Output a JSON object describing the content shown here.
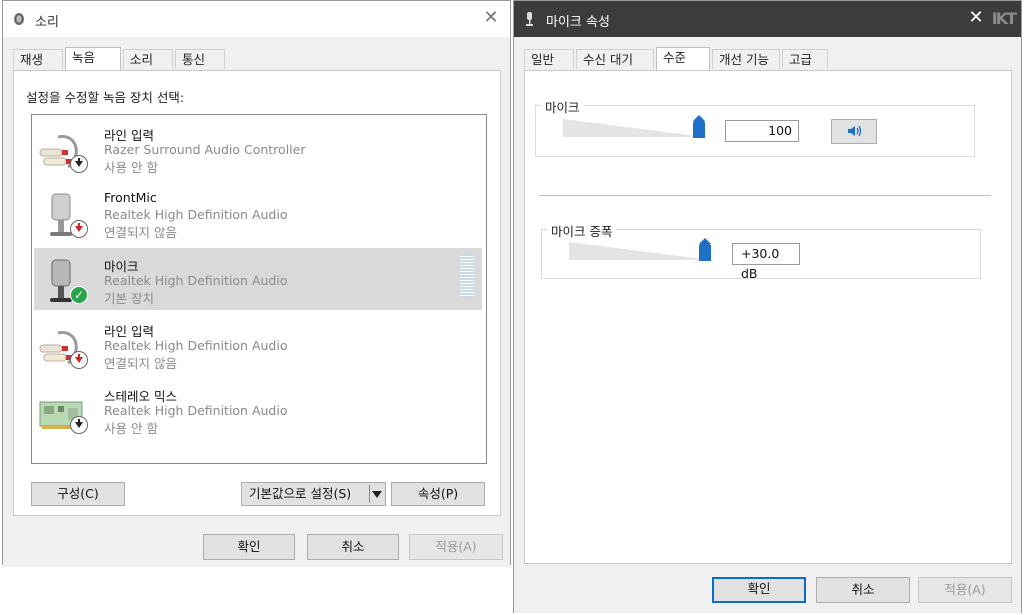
{
  "sound_dialog": {
    "title": "소리",
    "close_glyph": "✕",
    "tabs": [
      {
        "label": "재생",
        "active": false
      },
      {
        "label": "녹음",
        "active": true
      },
      {
        "label": "소리",
        "active": false
      },
      {
        "label": "통신",
        "active": false
      }
    ],
    "instruction": "설정을 수정할 녹음 장치 선택:",
    "devices": [
      {
        "name": "라인 입력",
        "description": "Razer Surround Audio Controller",
        "status": "사용 안 함",
        "icon": "line-in-jack-icon",
        "badge": "down-arrow",
        "badge_color": "#222222"
      },
      {
        "name": "FrontMic",
        "description": "Realtek High Definition Audio",
        "status": "연결되지 않음",
        "icon": "microphone-icon",
        "badge": "down-arrow",
        "badge_color": "#d32121"
      },
      {
        "name": "마이크",
        "description": "Realtek High Definition Audio",
        "status": "기본 장치",
        "icon": "microphone-icon",
        "badge": "check",
        "badge_color": "#2aa44a",
        "selected": true
      },
      {
        "name": "라인 입력",
        "description": "Realtek High Definition Audio",
        "status": "연결되지 않음",
        "icon": "line-in-jack-icon",
        "badge": "down-arrow",
        "badge_color": "#d32121"
      },
      {
        "name": "스테레오 믹스",
        "description": "Realtek High Definition Audio",
        "status": "사용 안 함",
        "icon": "sound-card-icon",
        "badge": "down-arrow",
        "badge_color": "#222222"
      }
    ],
    "configure_label": "구성(C)",
    "set_default_label": "기본값으로 설정(S)",
    "properties_label": "속성(P)",
    "ok_label": "확인",
    "cancel_label": "취소",
    "apply_label": "적용(A)"
  },
  "mic_properties": {
    "title": "마이크 속성",
    "close_glyph": "✕",
    "watermark": "IKT",
    "tabs": [
      {
        "label": "일반",
        "active": false
      },
      {
        "label": "수신 대기",
        "active": false
      },
      {
        "label": "수준",
        "active": true
      },
      {
        "label": "개선 기능",
        "active": false
      },
      {
        "label": "고급",
        "active": false
      }
    ],
    "mic_group_label": "마이크",
    "mic_level_value": "100",
    "mic_level_fraction": 1.0,
    "boost_group_label": "마이크 증폭",
    "boost_value": "+30.0 dB",
    "boost_level_fraction": 1.0,
    "ok_label": "확인",
    "cancel_label": "취소",
    "apply_label": "적용(A)"
  },
  "colors": {
    "accent": "#1e6fc6",
    "selection": "#d9d9d9",
    "dark_titlebar": "#3c3c3c",
    "default_check": "#2aa44a",
    "disconnected_arrow": "#d32121"
  }
}
